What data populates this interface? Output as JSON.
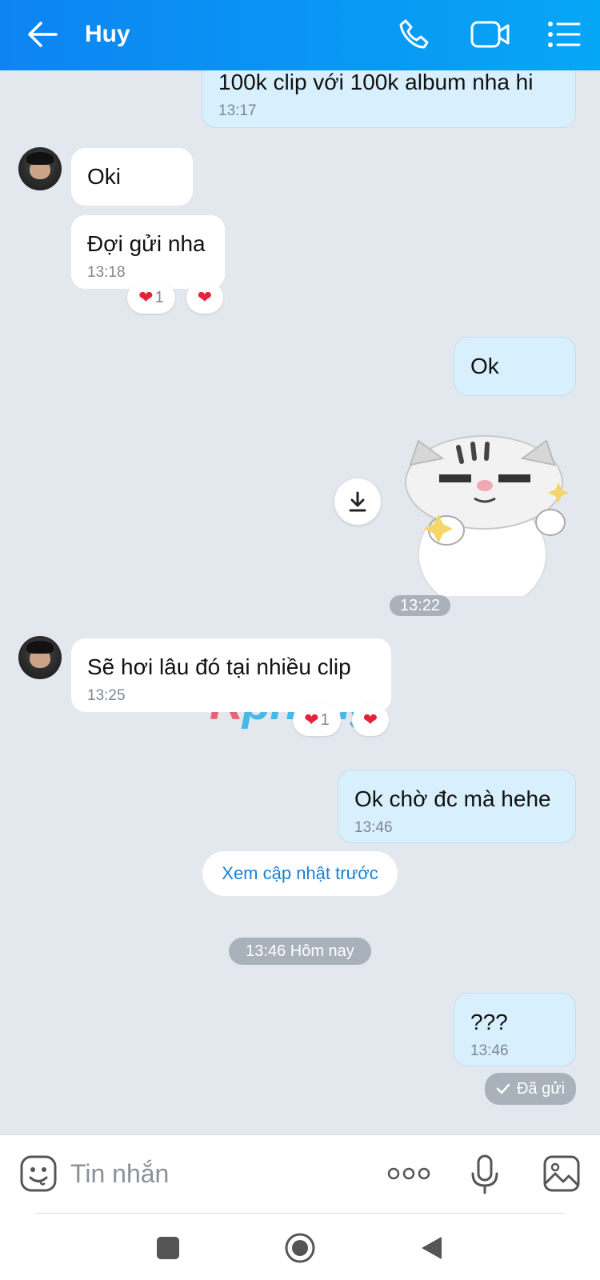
{
  "header": {
    "contact_name": "Huy",
    "background": "#0d84f2"
  },
  "messages": [
    {
      "text": "100k clip với 100k album nha hi",
      "time": "13:17"
    },
    {
      "text": "Oki"
    },
    {
      "text": "Đợi gửi nha",
      "time": "13:18",
      "reaction_count": "1"
    },
    {
      "text": "Ok"
    },
    {
      "sticker": "cat-thumbs-up-sticker"
    },
    {
      "text": "Sẽ hơi lâu đó tại nhiều clip",
      "time": "13:25",
      "reaction_count": "1"
    },
    {
      "text": "Ok chờ đc mà hehe",
      "time": "13:46"
    },
    {
      "text": "???",
      "time": "13:46"
    }
  ],
  "sticker_time": "13:22",
  "watermark": {
    "part1": "R",
    "part2": "phang"
  },
  "load_more_label": "Xem cập nhật trước",
  "date_separator": "13:46 Hôm nay",
  "status_sent": "Đã gửi",
  "composer": {
    "placeholder": "Tin nhắn"
  },
  "icons": [
    "back-arrow-icon",
    "phone-icon",
    "video-call-icon",
    "menu-list-icon",
    "heart-icon",
    "download-icon",
    "check-icon",
    "emoji-icon",
    "more-icon",
    "microphone-icon",
    "image-icon",
    "nav-recents-icon",
    "nav-home-icon",
    "nav-back-icon"
  ],
  "colors": {
    "incoming": "#ffffff",
    "outgoing": "#d8f0fd",
    "reaction": "#e5223a",
    "chat_bg": "#e3e8ef"
  }
}
